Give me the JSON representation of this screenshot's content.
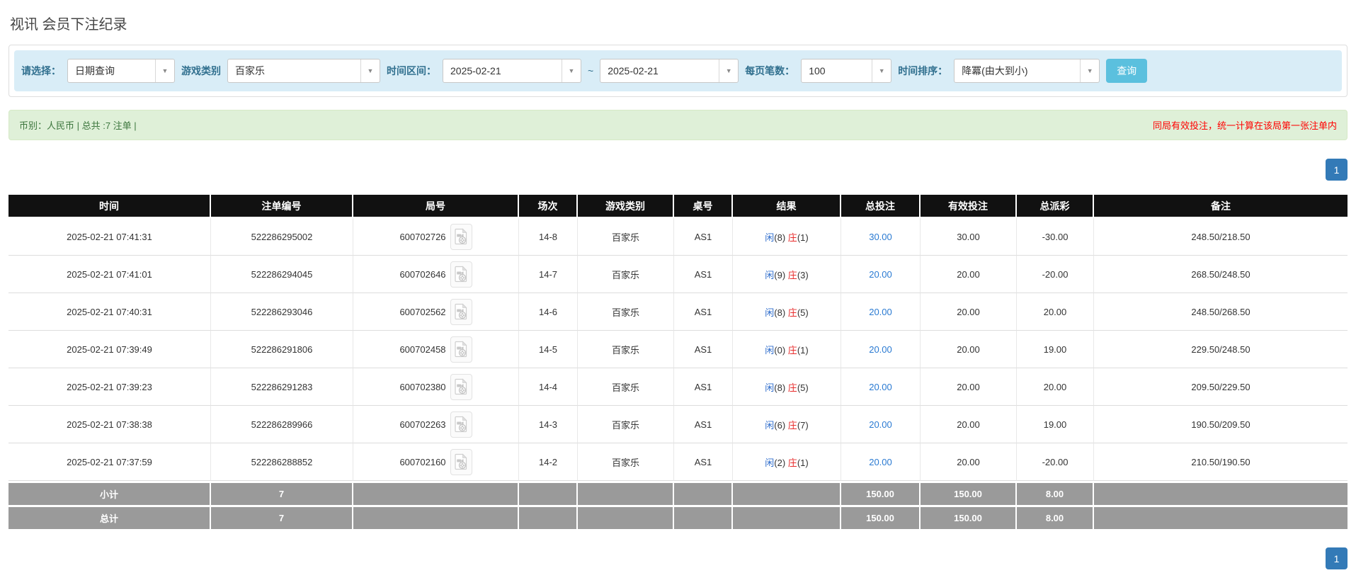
{
  "page": {
    "title": "视讯 会员下注纪录"
  },
  "filters": {
    "select_label": "请选择：",
    "select_value": "日期查询",
    "game_type_label": "游戏类别",
    "game_type_value": "百家乐",
    "date_range_label": "时间区间：",
    "date_from": "2025-02-21",
    "date_separator": "~",
    "date_to": "2025-02-21",
    "page_size_label": "每页笔数：",
    "page_size_value": "100",
    "sort_label": "时间排序：",
    "sort_value": "降冪(由大到小)",
    "search_button": "查询"
  },
  "summary": {
    "left_text": "币别：人民币 | 总共 :7 注单 |",
    "right_note": "同局有效投注，统一计算在该局第一张注单内"
  },
  "pagination": {
    "page": "1"
  },
  "table": {
    "headers": [
      "时间",
      "注单编号",
      "局号",
      "场次",
      "游戏类别",
      "桌号",
      "结果",
      "总投注",
      "有效投注",
      "总派彩",
      "备注"
    ],
    "result_labels": {
      "player": "闲",
      "banker": "庄"
    },
    "rows": [
      {
        "time": "2025-02-21 07:41:31",
        "bet_no": "522286295002",
        "round_no": "600702726",
        "session": "14-8",
        "game": "百家乐",
        "table_no": "AS1",
        "result": {
          "player": 8,
          "banker": 1
        },
        "total_bet": "30.00",
        "valid_bet": "30.00",
        "payout": "-30.00",
        "remark": "248.50/218.50"
      },
      {
        "time": "2025-02-21 07:41:01",
        "bet_no": "522286294045",
        "round_no": "600702646",
        "session": "14-7",
        "game": "百家乐",
        "table_no": "AS1",
        "result": {
          "player": 9,
          "banker": 3
        },
        "total_bet": "20.00",
        "valid_bet": "20.00",
        "payout": "-20.00",
        "remark": "268.50/248.50"
      },
      {
        "time": "2025-02-21 07:40:31",
        "bet_no": "522286293046",
        "round_no": "600702562",
        "session": "14-6",
        "game": "百家乐",
        "table_no": "AS1",
        "result": {
          "player": 8,
          "banker": 5
        },
        "total_bet": "20.00",
        "valid_bet": "20.00",
        "payout": "20.00",
        "remark": "248.50/268.50"
      },
      {
        "time": "2025-02-21 07:39:49",
        "bet_no": "522286291806",
        "round_no": "600702458",
        "session": "14-5",
        "game": "百家乐",
        "table_no": "AS1",
        "result": {
          "player": 0,
          "banker": 1
        },
        "total_bet": "20.00",
        "valid_bet": "20.00",
        "payout": "19.00",
        "remark": "229.50/248.50"
      },
      {
        "time": "2025-02-21 07:39:23",
        "bet_no": "522286291283",
        "round_no": "600702380",
        "session": "14-4",
        "game": "百家乐",
        "table_no": "AS1",
        "result": {
          "player": 8,
          "banker": 5
        },
        "total_bet": "20.00",
        "valid_bet": "20.00",
        "payout": "20.00",
        "remark": "209.50/229.50"
      },
      {
        "time": "2025-02-21 07:38:38",
        "bet_no": "522286289966",
        "round_no": "600702263",
        "session": "14-3",
        "game": "百家乐",
        "table_no": "AS1",
        "result": {
          "player": 6,
          "banker": 7
        },
        "total_bet": "20.00",
        "valid_bet": "20.00",
        "payout": "19.00",
        "remark": "190.50/209.50"
      },
      {
        "time": "2025-02-21 07:37:59",
        "bet_no": "522286288852",
        "round_no": "600702160",
        "session": "14-2",
        "game": "百家乐",
        "table_no": "AS1",
        "result": {
          "player": 2,
          "banker": 1
        },
        "total_bet": "20.00",
        "valid_bet": "20.00",
        "payout": "-20.00",
        "remark": "210.50/190.50"
      }
    ],
    "footer": [
      {
        "label": "小计",
        "count": "7",
        "total_bet": "150.00",
        "valid_bet": "150.00",
        "payout": "8.00"
      },
      {
        "label": "总计",
        "count": "7",
        "total_bet": "150.00",
        "valid_bet": "150.00",
        "payout": "8.00"
      }
    ]
  },
  "colors": {
    "search_button": "#5bc0de",
    "pagination_active": "#337ab7",
    "bet_link_blue": "#2a7ad2",
    "negative_red": "#e82b2b",
    "player_blue": "#2e6dcc",
    "banker_red": "#e82b2b",
    "summary_bg_green": "#dff0d8",
    "summary_text_green": "#3c763d",
    "filter_bar_bg": "#d9edf7",
    "header_bg": "#111111",
    "footer_bg": "#9a9a9a"
  }
}
